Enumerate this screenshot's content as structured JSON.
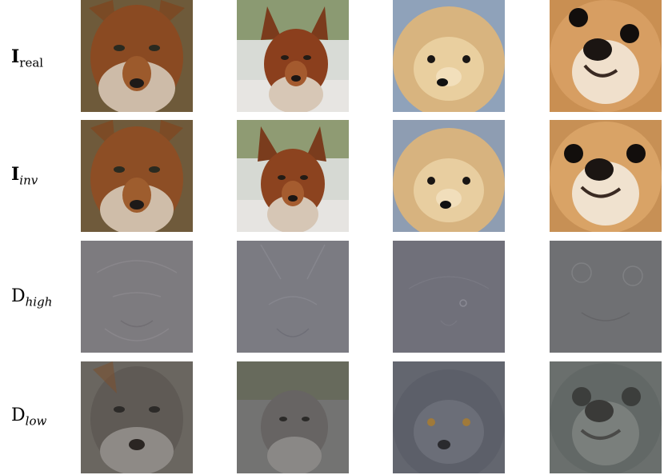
{
  "rows": [
    {
      "key": "real",
      "symbol": "I",
      "subscript": "real"
    },
    {
      "key": "inv",
      "symbol": "I",
      "subscript": "inv"
    },
    {
      "key": "high",
      "symbol": "D",
      "subscript": "high"
    },
    {
      "key": "low",
      "symbol": "D",
      "subscript": "low"
    }
  ],
  "columns": [
    {
      "subject": "dhole"
    },
    {
      "subject": "dhole"
    },
    {
      "subject": "pomeranian"
    },
    {
      "subject": "pekingese"
    }
  ],
  "colors": {
    "dhole_fur": "#8a4a22",
    "dhole_light": "#d9c7b5",
    "pom_fur": "#d8b47f",
    "peke_fur": "#c98f52",
    "high_gray": "#7c7b80",
    "low_gray": "#6d6f78"
  }
}
